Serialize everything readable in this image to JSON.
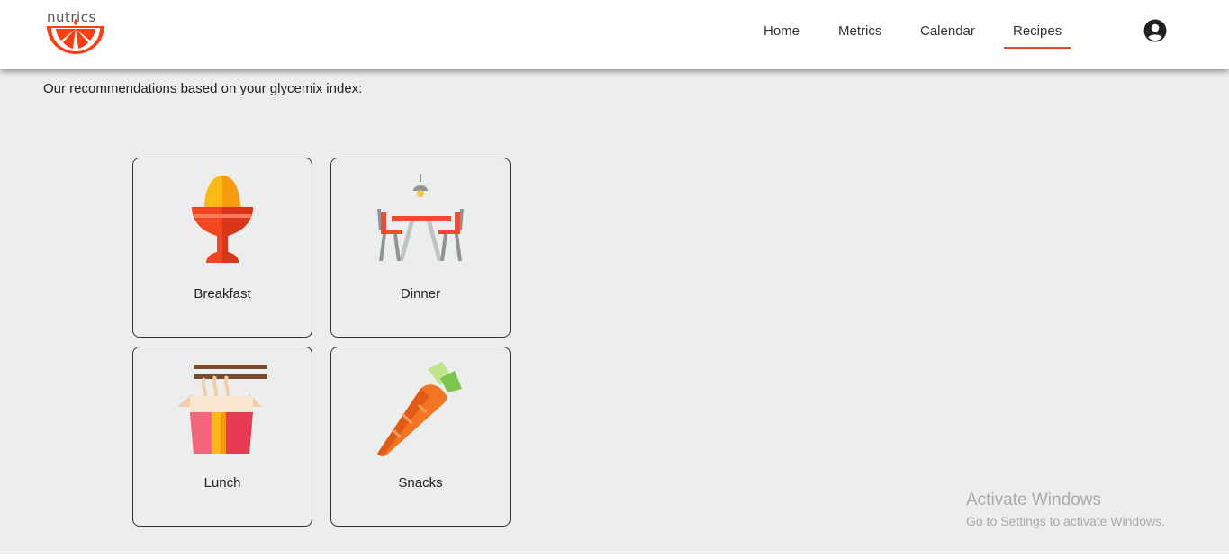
{
  "brand": {
    "name": "nutrics",
    "accent_color": "#e24b2a"
  },
  "nav": {
    "items": [
      {
        "label": "Home"
      },
      {
        "label": "Metrics"
      },
      {
        "label": "Calendar"
      },
      {
        "label": "Recipes"
      }
    ],
    "active": "Recipes"
  },
  "account": {
    "icon": "user-circle-icon"
  },
  "main": {
    "intro": "Our recommendations based on your glycemix index:",
    "cards": [
      {
        "label": "Breakfast",
        "icon": "egg-cup-icon"
      },
      {
        "label": "Dinner",
        "icon": "dining-table-icon"
      },
      {
        "label": "Lunch",
        "icon": "noodle-box-icon"
      },
      {
        "label": "Snacks",
        "icon": "carrot-icon"
      }
    ]
  },
  "watermark": {
    "title": "Activate Windows",
    "subtitle": "Go to Settings to activate Windows."
  }
}
